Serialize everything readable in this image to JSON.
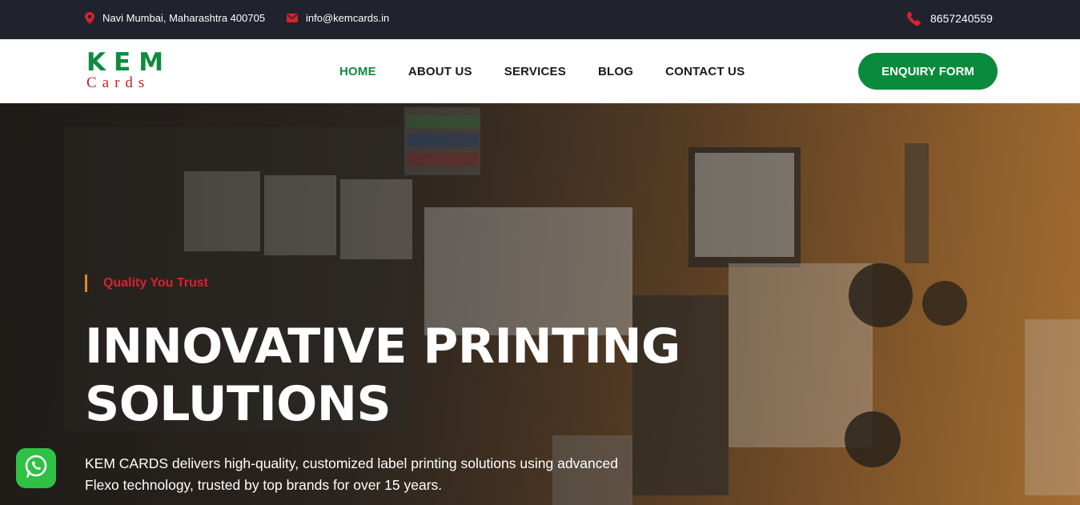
{
  "topbar": {
    "location": "Navi Mumbai, Maharashtra 400705",
    "email": "info@kemcards.in",
    "phone": "8657240559"
  },
  "logo": {
    "top": "KEM",
    "bottom": "Cards"
  },
  "nav": [
    {
      "label": "HOME",
      "active": true
    },
    {
      "label": "ABOUT US"
    },
    {
      "label": "SERVICES"
    },
    {
      "label": "BLOG"
    },
    {
      "label": "CONTACT US"
    }
  ],
  "header": {
    "cta_label": "ENQUIRY FORM"
  },
  "hero": {
    "tagline": "Quality You Trust",
    "headline_line1": "INNOVATIVE PRINTING",
    "headline_line2": "SOLUTIONS",
    "description": "KEM CARDS delivers high-quality, customized label printing solutions using advanced Flexo technology, trusted by top brands for over 15 years."
  },
  "colors": {
    "brand_green": "#0a8a3c",
    "brand_red": "#d1252c",
    "topbar_bg": "#20222e",
    "accent_orange": "#e0882a"
  },
  "icons": {
    "location": "map-pin-icon",
    "email": "envelope-icon",
    "phone": "phone-icon",
    "whatsapp": "whatsapp-icon"
  }
}
